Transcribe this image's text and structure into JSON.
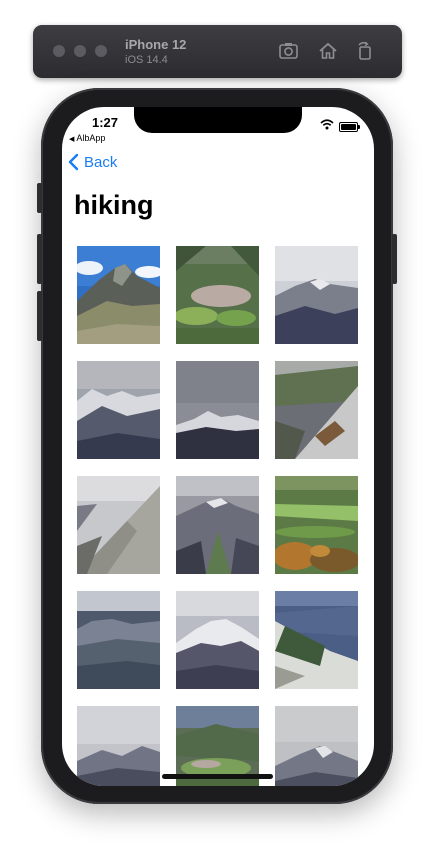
{
  "simulator": {
    "device_name": "iPhone 12",
    "os_version": "iOS 14.4",
    "buttons": [
      "screenshot-icon",
      "home-icon",
      "rotate-icon"
    ]
  },
  "status_bar": {
    "time": "1:27",
    "back_app": "AlbApp"
  },
  "nav": {
    "back_label": "Back",
    "title": "hiking"
  },
  "accent_color": "#1a7cf5",
  "photos_visible": 15
}
